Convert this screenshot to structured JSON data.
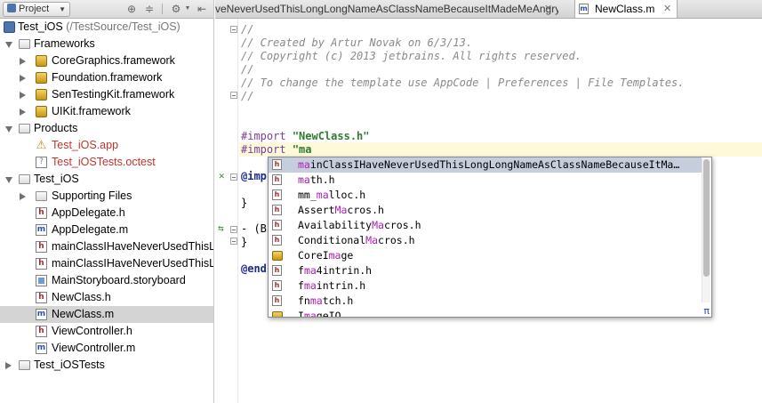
{
  "toolbar": {
    "project_label": "Project",
    "icons": [
      "target-icon",
      "collapse-icon",
      "gear-icon",
      "hide-icon"
    ]
  },
  "tree": {
    "items": [
      {
        "label": "Test_iOS",
        "suffix": " (/TestSource/Test_iOS)",
        "kind": "project",
        "expanded": true
      },
      {
        "label": "Frameworks",
        "kind": "folder",
        "expanded": true
      },
      {
        "label": "CoreGraphics.framework",
        "kind": "framework",
        "expanded": false
      },
      {
        "label": "Foundation.framework",
        "kind": "framework",
        "expanded": false
      },
      {
        "label": "SenTestingKit.framework",
        "kind": "framework",
        "expanded": false
      },
      {
        "label": "UIKit.framework",
        "kind": "framework",
        "expanded": false
      },
      {
        "label": "Products",
        "kind": "folder",
        "expanded": true
      },
      {
        "label": "Test_iOS.app",
        "kind": "app",
        "color": "red"
      },
      {
        "label": "Test_iOSTests.octest",
        "kind": "unknown",
        "color": "red"
      },
      {
        "label": "Test_iOS",
        "kind": "folder",
        "expanded": true
      },
      {
        "label": "Supporting Files",
        "kind": "folder",
        "expanded": false
      },
      {
        "label": "AppDelegate.h",
        "kind": "h"
      },
      {
        "label": "AppDelegate.m",
        "kind": "m"
      },
      {
        "label": "mainClassIHaveNeverUsedThisL",
        "kind": "h"
      },
      {
        "label": "mainClassIHaveNeverUsedThisL",
        "kind": "m"
      },
      {
        "label": "MainStoryboard.storyboard",
        "kind": "storyboard"
      },
      {
        "label": "NewClass.h",
        "kind": "h"
      },
      {
        "label": "NewClass.m",
        "kind": "m",
        "selected": true
      },
      {
        "label": "ViewController.h",
        "kind": "h"
      },
      {
        "label": "ViewController.m",
        "kind": "m"
      },
      {
        "label": "Test_iOSTests",
        "kind": "folder",
        "expanded": false
      }
    ]
  },
  "tabs": [
    {
      "label": "veNeverUsedThisLongLongNameAsClassNameBecauseItMadeMeAngry.m",
      "active": false
    },
    {
      "label": "NewClass.m",
      "active": true
    }
  ],
  "editor": {
    "comment_lines": [
      "//",
      "// Created by Artur Novak on 6/3/13.",
      "// Copyright (c) 2013 jetbrains. All rights reserved.",
      "//",
      "// To change the template use AppCode | Preferences | File Templates.",
      "//"
    ],
    "import1_directive": "#import",
    "import1_value": "\"NewClass.h\"",
    "import2_directive": "#import",
    "import2_value": "\"ma",
    "impl_visible": "@imp",
    "brace_close_1": "}",
    "method_visible": "- (B",
    "brace_close_2": "}",
    "end_visible": "@end"
  },
  "completion": {
    "items": [
      {
        "match": "ma",
        "rest": "inClassIHaveNeverUsedThisLongLongNameAsClassNameBecauseItMa…",
        "kind": "h",
        "selected": true
      },
      {
        "pre": "",
        "match": "ma",
        "rest": "th.h",
        "kind": "h"
      },
      {
        "pre": "mm_",
        "match": "ma",
        "rest": "lloc.h",
        "kind": "h"
      },
      {
        "pre": "Assert",
        "match": "Ma",
        "rest": "cros.h",
        "kind": "h"
      },
      {
        "pre": "Availability",
        "match": "Ma",
        "rest": "cros.h",
        "kind": "h"
      },
      {
        "pre": "Conditional",
        "match": "Ma",
        "rest": "cros.h",
        "kind": "h"
      },
      {
        "pre": "CoreI",
        "match": "ma",
        "rest": "ge",
        "kind": "framework"
      },
      {
        "pre": "f",
        "match": "ma",
        "rest": "4intrin.h",
        "kind": "h"
      },
      {
        "pre": "f",
        "match": "ma",
        "rest": "intrin.h",
        "kind": "h"
      },
      {
        "pre": "fn",
        "match": "ma",
        "rest": "tch.h",
        "kind": "h"
      },
      {
        "pre": "I",
        "match": "ma",
        "rest": "geIO",
        "kind": "framework"
      }
    ],
    "footer_symbol": "π"
  },
  "colors": {
    "selection": "#d4d4d4",
    "popup_selection": "#c6cede",
    "match_highlight": "#b21cb5",
    "comment": "#8a8a8a",
    "string": "#2f7d2f",
    "directive": "#7a3e9d",
    "product_red": "#c0342b"
  }
}
